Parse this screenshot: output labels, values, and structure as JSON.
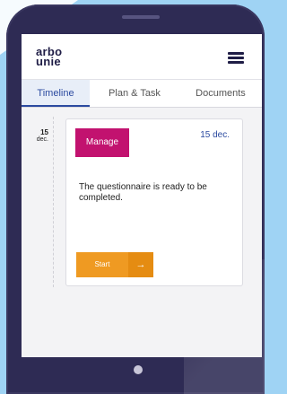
{
  "app": {
    "logo_line1": "arbo",
    "logo_line2": "unie"
  },
  "tabs": [
    {
      "label": "Timeline",
      "active": true
    },
    {
      "label": "Plan & Task",
      "active": false
    },
    {
      "label": "Documents",
      "active": false
    }
  ],
  "timeline": {
    "day": "15",
    "month": "dec."
  },
  "card": {
    "manage_label": "Manage",
    "date": "15 dec.",
    "message": "The questionnaire is ready to be completed.",
    "start_label": "Start",
    "start_arrow": "→"
  },
  "colors": {
    "brand_navy": "#1f1d46",
    "accent_magenta": "#c2126f",
    "accent_orange": "#ef9a22",
    "link_blue": "#2b4aa0",
    "background": "#9fd3f4"
  },
  "icons": {
    "menu": "hamburger-menu-icon",
    "arrow": "arrow-right-icon"
  }
}
